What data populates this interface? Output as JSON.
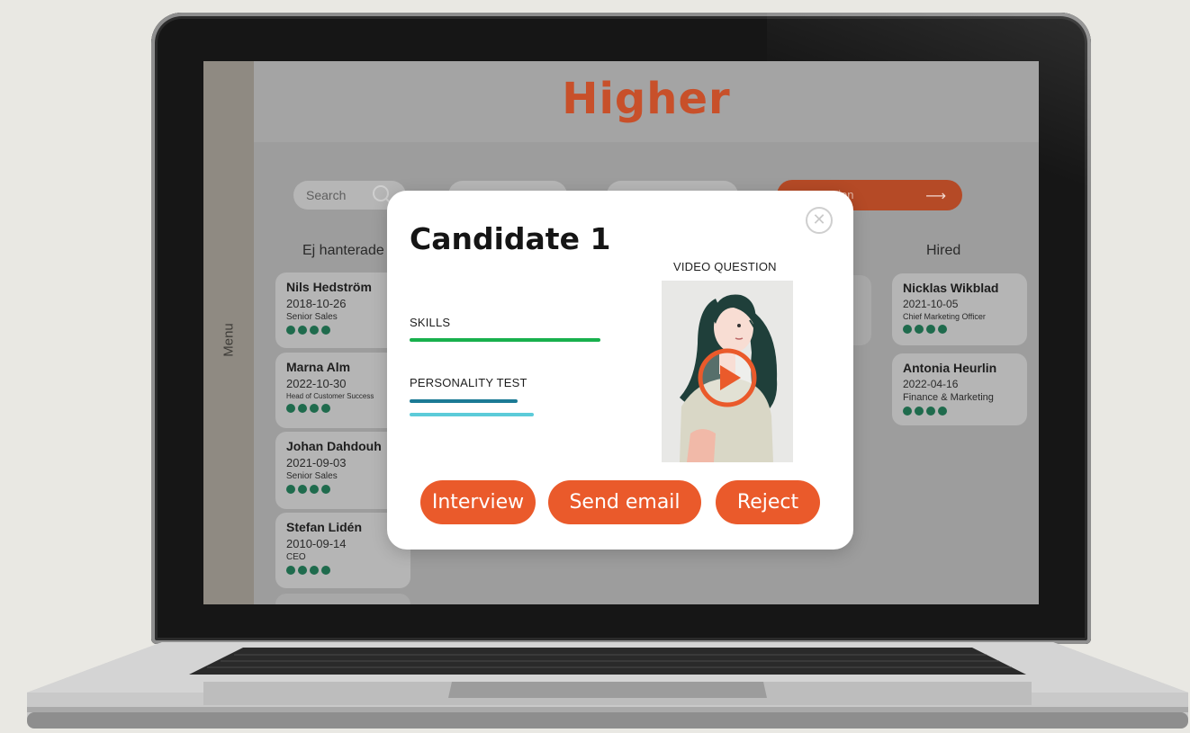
{
  "app": {
    "logo": "Higher",
    "menu_label": "Menu"
  },
  "toolbar": {
    "search_placeholder": "Search",
    "action_label": "ction",
    "action_icon": "arrow-right-icon"
  },
  "columns": {
    "left_header": "Ej hanterade",
    "right_header": "Hired"
  },
  "left_cards": [
    {
      "name": "Nils Hedström",
      "date": "2018-10-26",
      "role": "Senior Sales"
    },
    {
      "name": "Marna Alm",
      "date": "2022-10-30",
      "role": "Head of Customer Success"
    },
    {
      "name": "Johan Dahdouh",
      "date": "2021-09-03",
      "role": "Senior Sales"
    },
    {
      "name": "Stefan Lidén",
      "date": "2010-09-14",
      "role": "CEO"
    }
  ],
  "right_cards": [
    {
      "name": "Nicklas Wikblad",
      "date": "2021-10-05",
      "role": "Chief Marketing Officer"
    },
    {
      "name": "Antonia Heurlin",
      "date": "2022-04-16",
      "role": "Finance & Marketing"
    }
  ],
  "modal": {
    "title": "Candidate 1",
    "skills_label": "SKILLS",
    "skills_level": 1.0,
    "personality_label": "PERSONALITY TEST",
    "video_label": "VIDEO QUESTION",
    "close_icon": "close-icon",
    "play_icon": "play-icon",
    "buttons": {
      "interview": "Interview",
      "send_email": "Send email",
      "reject": "Reject"
    }
  },
  "colors": {
    "brand": "#c8502a",
    "button": "#ea5a2b",
    "skills_bar": "#18b04d",
    "personality_bar_1": "#1b7a95",
    "personality_bar_2": "#5ccbd9",
    "status_dot": "#1f6b4d"
  }
}
